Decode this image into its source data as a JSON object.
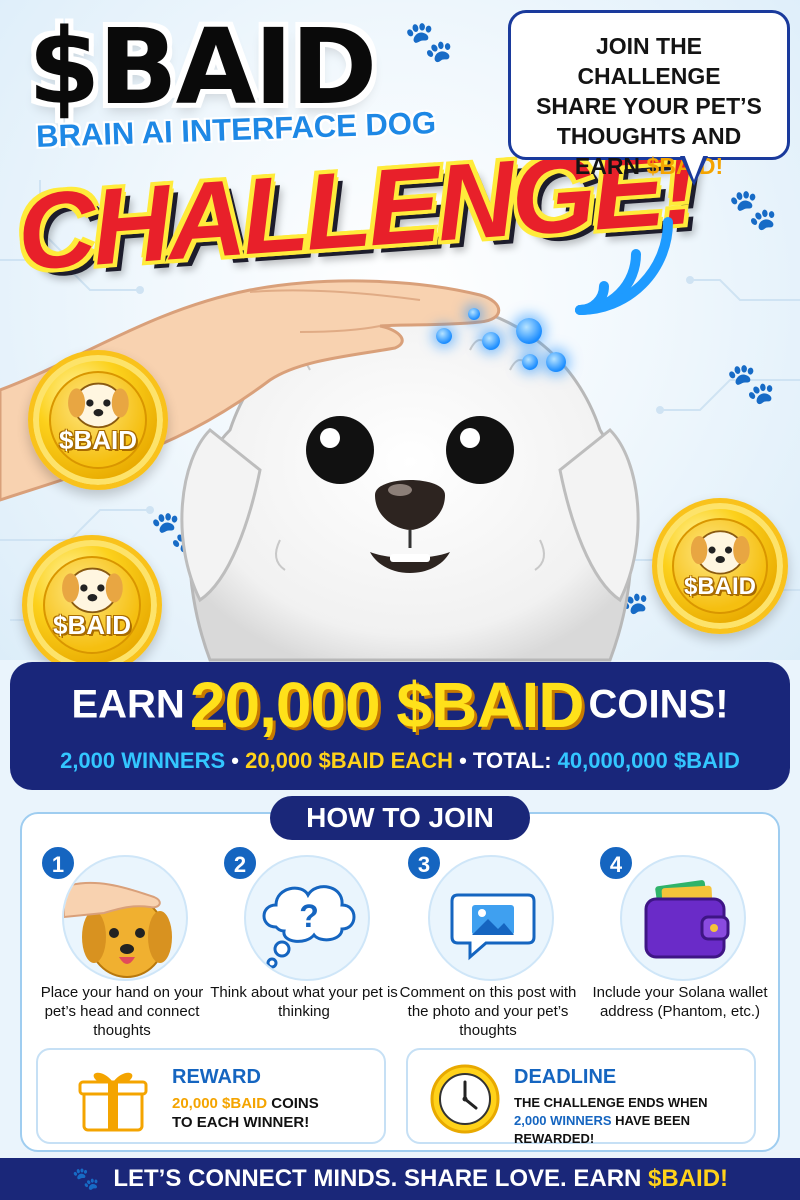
{
  "header": {
    "title": "$BAID",
    "subtitle": "BRAIN AI INTERFACE DOG",
    "headline": "CHALLENGE!"
  },
  "bubble": {
    "line1": "JOIN THE CHALLENGE",
    "line2": "SHARE YOUR PET’S",
    "line3": "THOUGHTS AND",
    "line4_prefix": "EARN ",
    "line4_token": "$BAID!"
  },
  "coins": {
    "label": "$BAID"
  },
  "earn_banner": {
    "earn": "EARN",
    "amount": "20,000 $BAID",
    "coins": "COINS!",
    "winners": "2,000 WINNERS",
    "sep": "•",
    "each": "20,000 $BAID EACH",
    "total_label": "TOTAL:",
    "total_value": "40,000,000 $BAID"
  },
  "how_to_join": {
    "title": "HOW TO JOIN",
    "steps": [
      {
        "num": "1",
        "text": "Place your hand on your pet’s head and connect thoughts",
        "icon": "hand-on-dog-icon"
      },
      {
        "num": "2",
        "text": "Think about what your pet is thinking",
        "icon": "thought-bubble-icon"
      },
      {
        "num": "3",
        "text": "Comment on this post with the photo and your pet’s thoughts",
        "icon": "image-comment-icon"
      },
      {
        "num": "4",
        "text": "Include your Solana wallet address (Phantom, etc.)",
        "icon": "wallet-icon"
      }
    ]
  },
  "reward": {
    "title": "REWARD",
    "amount": "20,000 $BAID",
    "amount_suffix": " COINS",
    "line2": "TO EACH WINNER!"
  },
  "deadline": {
    "title": "DEADLINE",
    "line1": "THE CHALLENGE ENDS WHEN",
    "highlight": "2,000 WINNERS",
    "line2_suffix": " HAVE BEEN",
    "line3": "REWARDED!"
  },
  "footer": {
    "text": "LET’S CONNECT MINDS. SHARE LOVE. EARN ",
    "highlight": "$BAID!"
  },
  "colors": {
    "navy": "#1a2779",
    "accent_red": "#e8202a",
    "accent_yellow": "#ffd21a",
    "accent_blue": "#1565c0"
  }
}
